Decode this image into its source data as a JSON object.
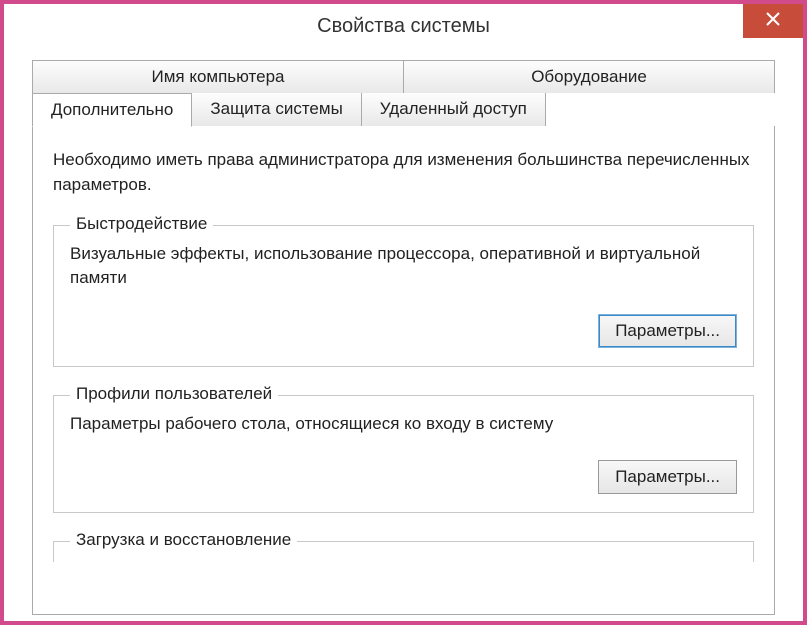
{
  "window": {
    "title": "Свойства системы"
  },
  "tabs": {
    "top": [
      {
        "label": "Имя компьютера"
      },
      {
        "label": "Оборудование"
      }
    ],
    "bottom": [
      {
        "label": "Дополнительно",
        "active": true
      },
      {
        "label": "Защита системы"
      },
      {
        "label": "Удаленный доступ"
      }
    ]
  },
  "panel": {
    "admin_note": "Необходимо иметь права администратора для изменения большинства перечисленных параметров.",
    "performance": {
      "legend": "Быстродействие",
      "desc": "Визуальные эффекты, использование процессора, оперативной и виртуальной памяти",
      "button": "Параметры..."
    },
    "profiles": {
      "legend": "Профили пользователей",
      "desc": "Параметры рабочего стола, относящиеся ко входу в систему",
      "button": "Параметры..."
    },
    "startup": {
      "legend": "Загрузка и восстановление"
    }
  }
}
